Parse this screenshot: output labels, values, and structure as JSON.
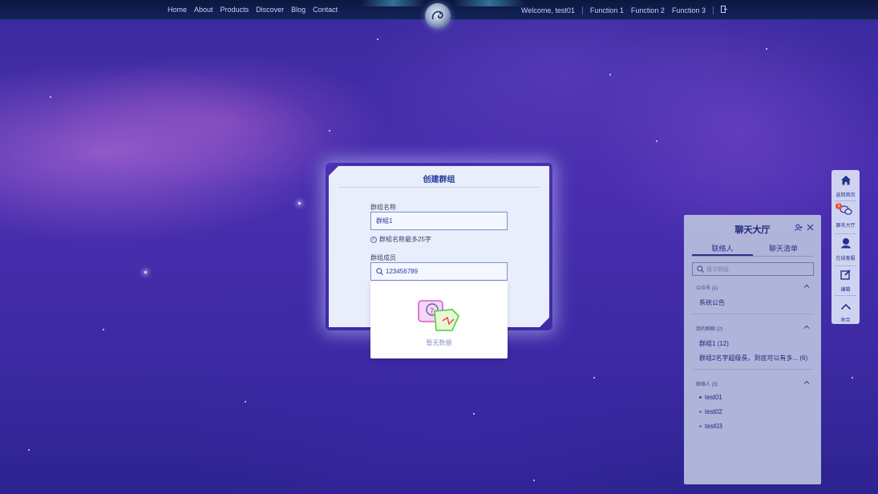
{
  "header": {
    "nav": [
      "Home",
      "About",
      "Products",
      "Discover",
      "Blog",
      "Contact"
    ],
    "welcome": "Welcome, test01",
    "functions": [
      "Function 1",
      "Function 2",
      "Function 3"
    ]
  },
  "dialog": {
    "title": "创建群组",
    "group_name_label": "群组名称",
    "group_name_value": "群組1",
    "group_name_hint": "群組名称最多25字",
    "members_label": "群组成员",
    "members_search_value": "123456789",
    "empty_text": "暂无数据"
  },
  "chat": {
    "title": "聊天大厅",
    "tabs": [
      "联络人",
      "聊天清单"
    ],
    "search_placeholder": "搜寻群组",
    "sections": {
      "official": {
        "title": "公众号 (1)",
        "items": [
          "系统公告"
        ]
      },
      "groups": {
        "title": "我的群聊 (2)",
        "items": [
          "群组1 (12)",
          "群组2名字超级長，到底可以有多... (6)"
        ]
      },
      "contacts": {
        "title": "联络人 (3)",
        "items": [
          "test01",
          "test02",
          "test03"
        ]
      }
    }
  },
  "floatmenu": {
    "home": "返回首页",
    "chat": "聊天大厅",
    "chat_badge": "1",
    "service": "在线客服",
    "edit": "编辑",
    "collapse": "收合"
  },
  "colors": {
    "accent": "#2a3a9c",
    "dialog_bg": "#e8eefb",
    "topbar_bg": "#0c1740"
  }
}
